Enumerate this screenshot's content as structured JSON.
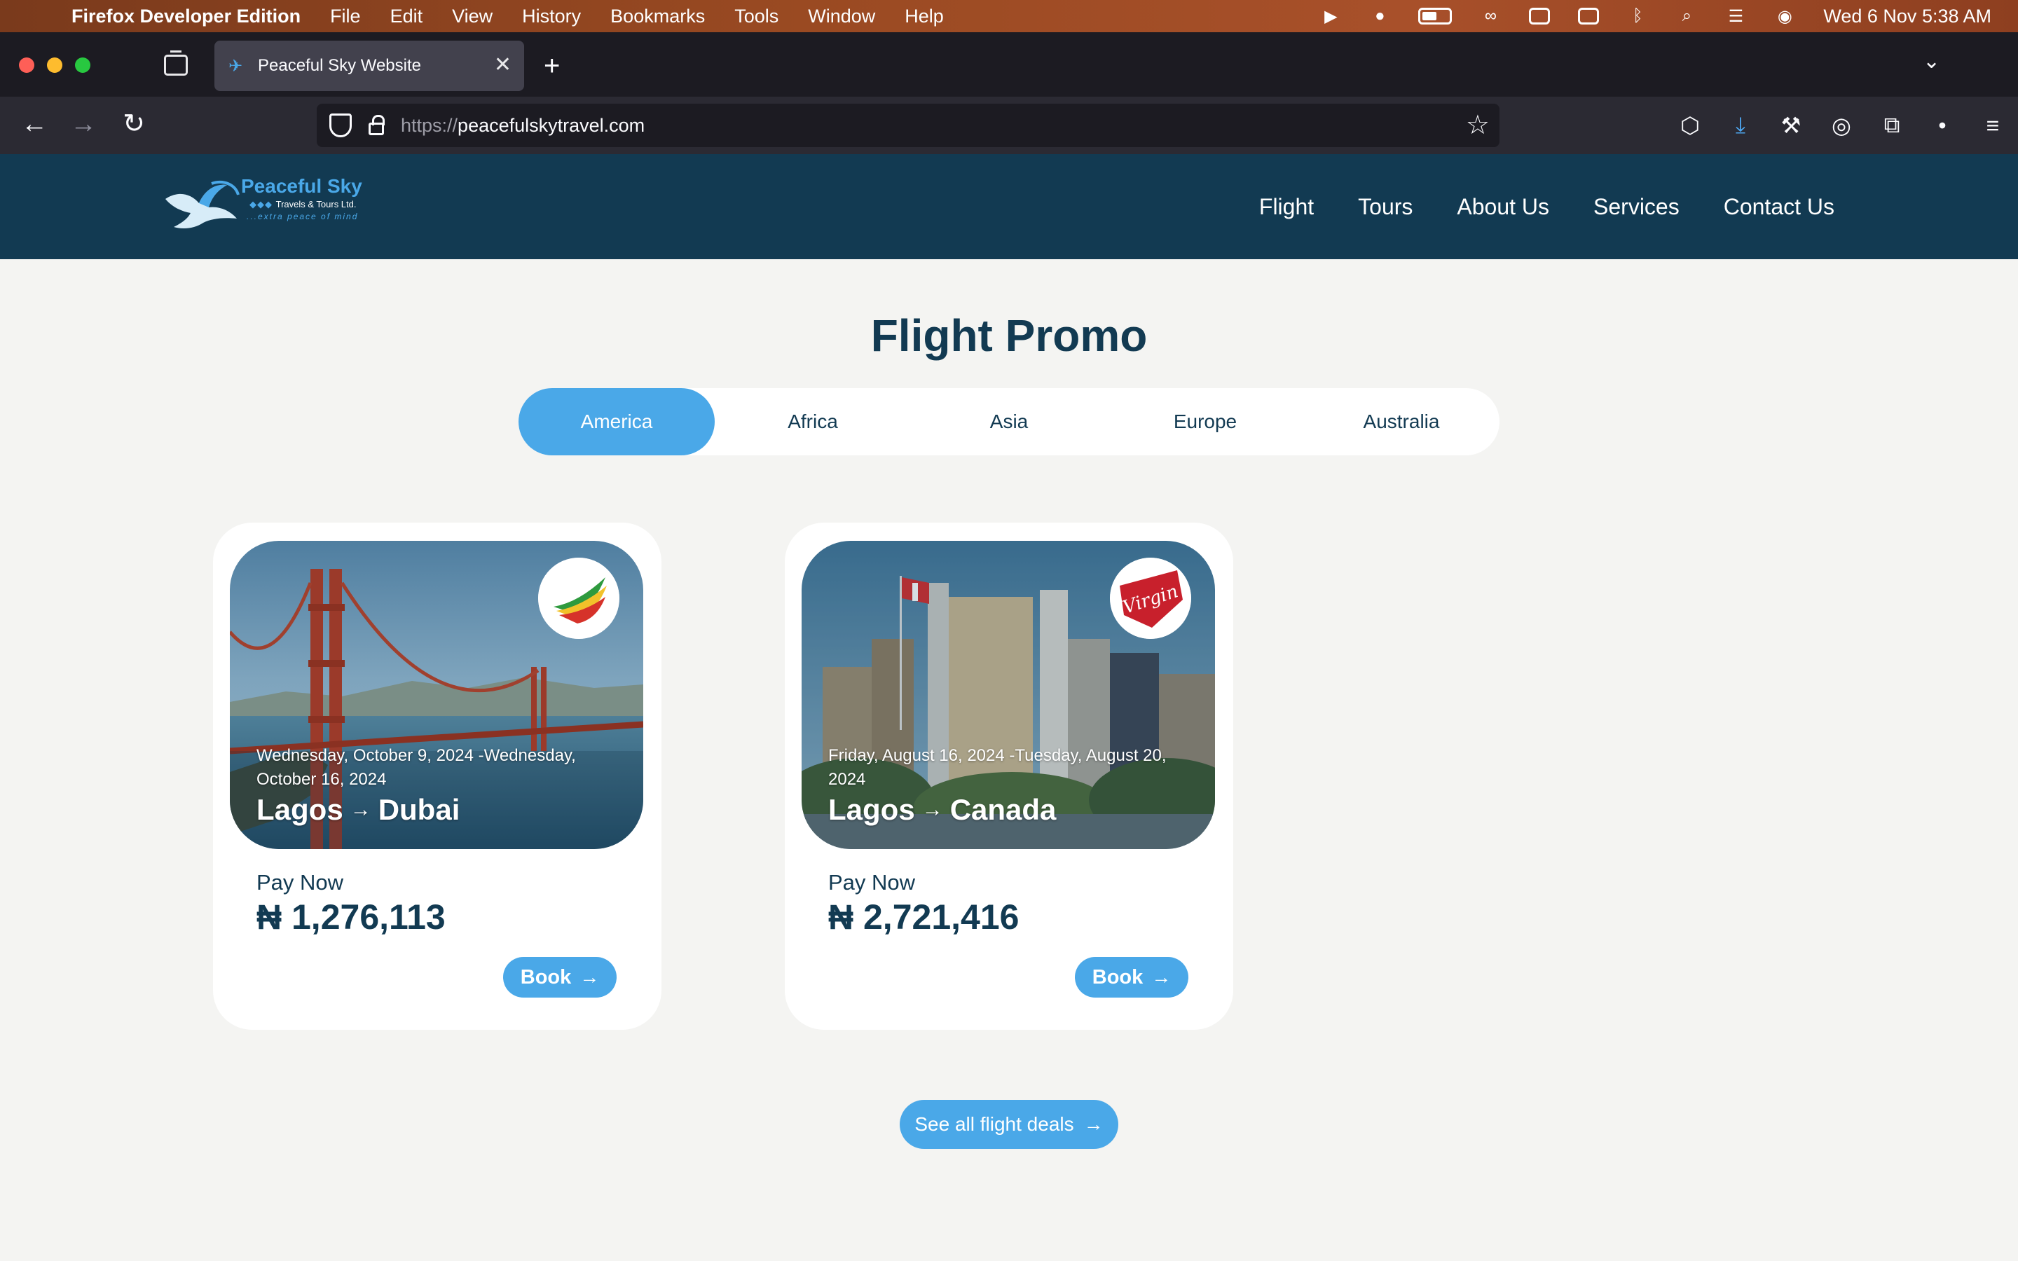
{
  "menubar": {
    "app_name": "Firefox Developer Edition",
    "menus": [
      "File",
      "Edit",
      "View",
      "History",
      "Bookmarks",
      "Tools",
      "Window",
      "Help"
    ],
    "clock": "Wed 6 Nov  5:38 AM"
  },
  "browser": {
    "tab_title": "Peaceful Sky Website",
    "url_protocol": "https://",
    "url_host": "peacefulskytravel.com"
  },
  "site": {
    "logo": {
      "title": "Peaceful Sky",
      "subtitle": "Travels & Tours Ltd.",
      "tagline": "...extra peace of mind"
    },
    "nav": [
      "Flight",
      "Tours",
      "About Us",
      "Services",
      "Contact Us"
    ]
  },
  "promo": {
    "title": "Flight Promo",
    "regions": [
      "America",
      "Africa",
      "Asia",
      "Europe",
      "Australia"
    ],
    "active_region": "America",
    "cards": [
      {
        "dates": "Wednesday, October 9, 2024 -Wednesday, October 16, 2024",
        "origin": "Lagos",
        "destination": "Dubai",
        "pay_label": "Pay Now",
        "price": "₦ 1,276,113",
        "button": "Book"
      },
      {
        "dates": "Friday, August 16, 2024 -Tuesday, August 20, 2024",
        "origin": "Lagos",
        "destination": "Canada",
        "pay_label": "Pay Now",
        "price": "₦ 2,721,416",
        "button": "Book",
        "airline_logo_text": "Virgin"
      }
    ],
    "see_all": "See all flight deals"
  },
  "colors": {
    "header_bg": "#123a52",
    "accent": "#4aa8e8",
    "page_bg": "#f4f4f2"
  }
}
